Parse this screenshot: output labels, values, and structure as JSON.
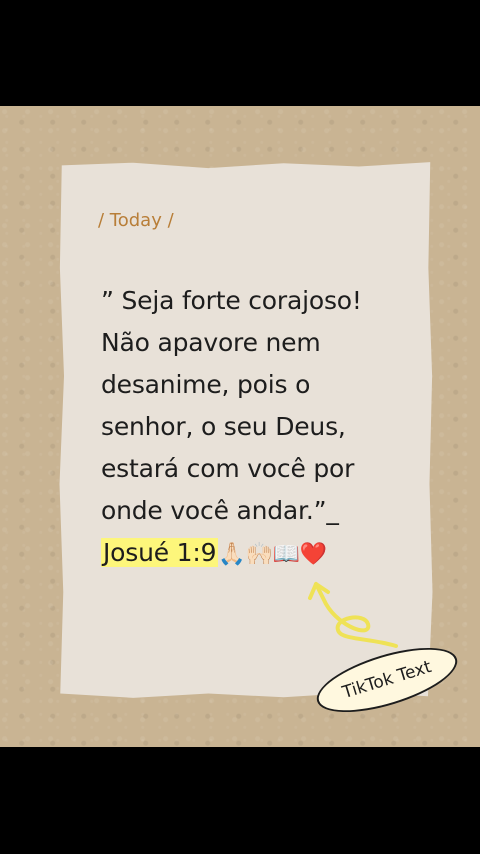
{
  "header": {
    "label": "/ Today /"
  },
  "quote": {
    "lines": [
      "” Seja forte corajoso!",
      "Não  apavore nem",
      "desanime, pois o",
      "senhor, o seu Deus,",
      "estará com você por",
      "onde você andar.”_"
    ],
    "reference": "Josué 1:9",
    "emojis": "🙏🏻🙌🏻📖❤️"
  },
  "tag": {
    "label": "TikTok Text"
  },
  "colors": {
    "highlight": "#fdf67b",
    "arrow": "#efe256",
    "label": "#b87e38"
  }
}
